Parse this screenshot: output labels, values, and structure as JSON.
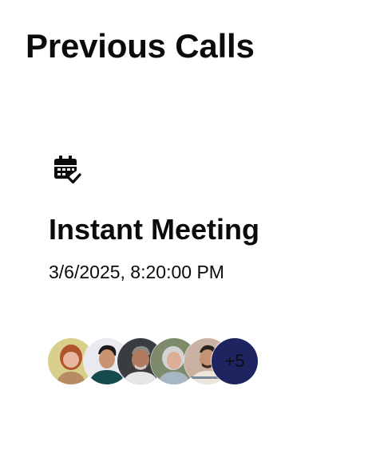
{
  "page": {
    "title": "Previous Calls"
  },
  "call": {
    "icon": "calendar-check-icon",
    "title": "Instant Meeting",
    "datetime": "3/6/2025, 8:20:00 PM",
    "participants": [
      {
        "icon": "participant-avatar-1",
        "bg": "#d8cf8a"
      },
      {
        "icon": "participant-avatar-2",
        "bg": "#e9e9ef"
      },
      {
        "icon": "participant-avatar-3",
        "bg": "#3a3d40"
      },
      {
        "icon": "participant-avatar-4",
        "bg": "#7e8b6a"
      },
      {
        "icon": "participant-avatar-5",
        "bg": "#c9b2a2"
      }
    ],
    "more_count": "+5"
  },
  "colors": {
    "text": "#0b0b0b",
    "more_badge": "#1e245f"
  }
}
